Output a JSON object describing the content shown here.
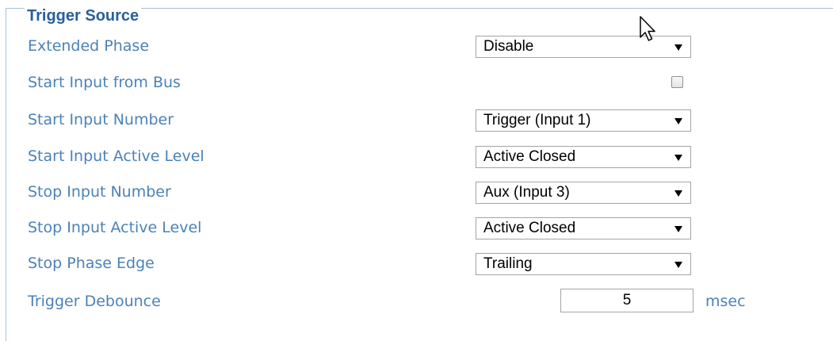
{
  "section": {
    "title": "Trigger Source"
  },
  "rows": {
    "extended_phase": {
      "label": "Extended Phase",
      "value": "Disable"
    },
    "start_input_from_bus": {
      "label": "Start Input from Bus",
      "checked": false
    },
    "start_input_number": {
      "label": "Start Input Number",
      "value": "Trigger (Input 1)"
    },
    "start_input_active_level": {
      "label": "Start Input Active Level",
      "value": "Active Closed"
    },
    "stop_input_number": {
      "label": "Stop Input Number",
      "value": "Aux (Input 3)"
    },
    "stop_input_active_level": {
      "label": "Stop Input Active Level",
      "value": "Active Closed"
    },
    "stop_phase_edge": {
      "label": "Stop Phase Edge",
      "value": "Trailing"
    },
    "trigger_debounce": {
      "label": "Trigger Debounce",
      "value": "5",
      "unit": "msec"
    }
  },
  "icons": {
    "cursor": "mouse-pointer-icon",
    "dropdown": "triangle-down-icon"
  },
  "colors": {
    "title": "#2a5f9a",
    "label": "#4b82b8",
    "border": "#a7c1d6"
  }
}
